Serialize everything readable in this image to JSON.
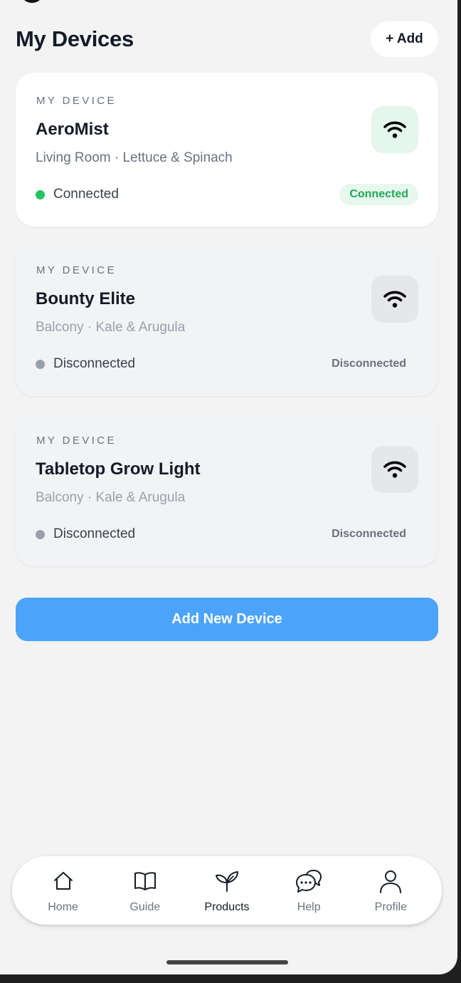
{
  "header": {
    "title": "My Devices",
    "add_label": "+ Add"
  },
  "devices": [
    {
      "eyebrow": "MY DEVICE",
      "name": "AeroMist",
      "location": "Living Room · Lettuce & Spinach",
      "status": "Connected",
      "badge": "Connected",
      "connected": true
    },
    {
      "eyebrow": "MY DEVICE",
      "name": "Bounty Elite",
      "location": "Balcony · Kale & Arugula",
      "status": "Disconnected",
      "badge": "Disconnected",
      "connected": false
    },
    {
      "eyebrow": "MY DEVICE",
      "name": "Tabletop Grow Light",
      "location": "Balcony · Kale & Arugula",
      "status": "Disconnected",
      "badge": "Disconnected",
      "connected": false
    }
  ],
  "primary_action": {
    "label": "Add New Device"
  },
  "tabs": [
    {
      "label": "Home",
      "icon": "home-icon"
    },
    {
      "label": "Guide",
      "icon": "book-icon"
    },
    {
      "label": "Products",
      "icon": "sprout-icon",
      "active": true
    },
    {
      "label": "Help",
      "icon": "chat-bubble-icon"
    },
    {
      "label": "Profile",
      "icon": "user-icon"
    }
  ],
  "colors": {
    "accent": "#4ba3fa",
    "connected": "#22c55e",
    "connected_text": "#1fa855",
    "disconnected": "#9aa0ab"
  }
}
